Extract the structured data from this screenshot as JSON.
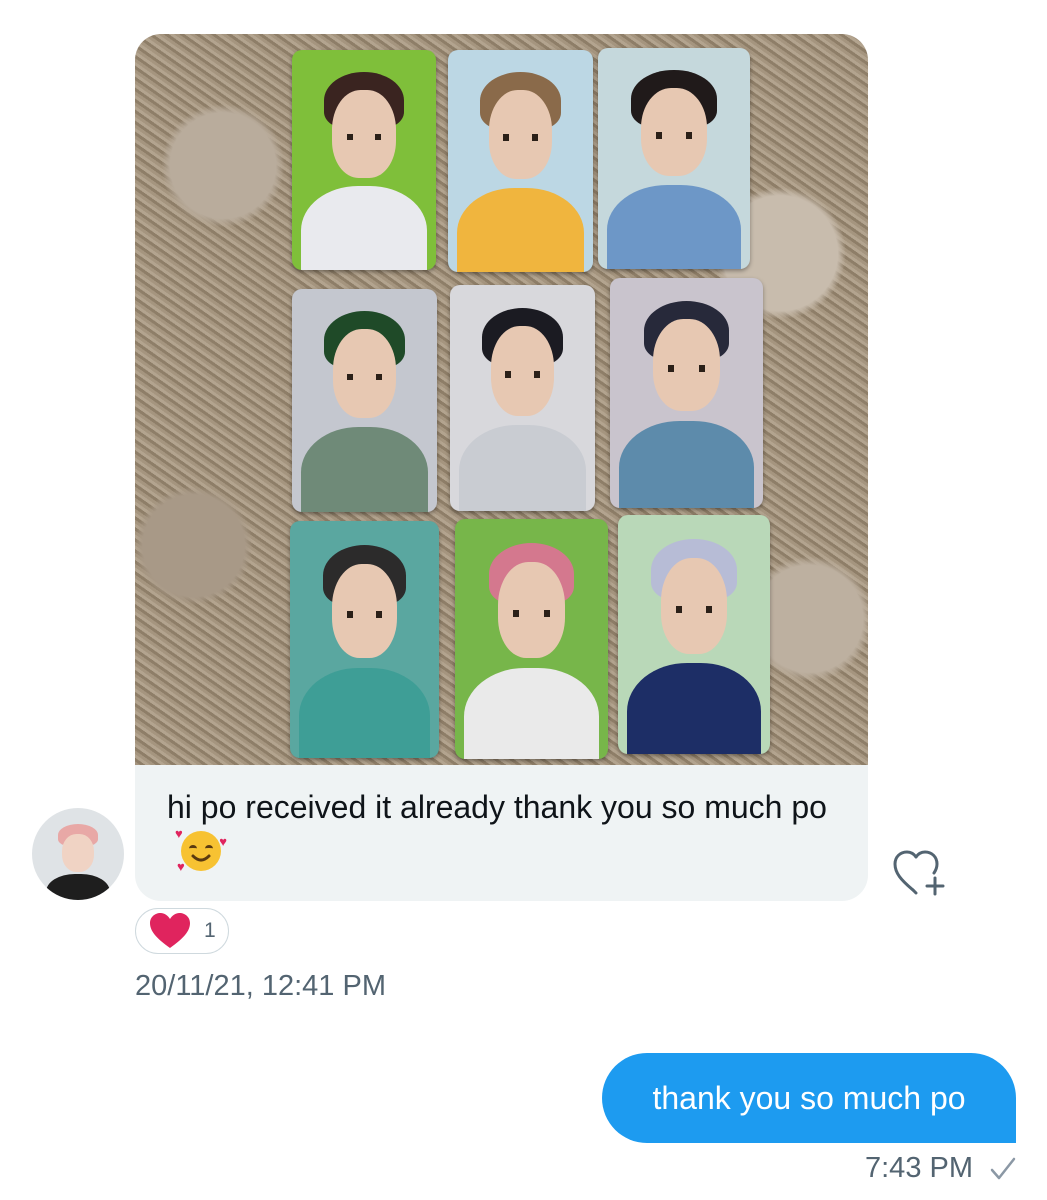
{
  "incoming_message": {
    "text": "hi po received it already thank you so much po",
    "emoji": "smiling-face-with-hearts",
    "timestamp": "20/11/21, 12:41 PM",
    "reaction": {
      "emoji": "heart",
      "count": "1"
    },
    "photo_cards": [
      {
        "bg": "#7fbf3a",
        "hair": "#3a2420",
        "shirt": "#e9eaee"
      },
      {
        "bg": "#bcd7e4",
        "hair": "#8a6a4a",
        "shirt": "#f0b53e"
      },
      {
        "bg": "#c5d8dc",
        "hair": "#201a1a",
        "shirt": "#6d97c7"
      },
      {
        "bg": "#c4c7cf",
        "hair": "#1f4a28",
        "shirt": "#6f8a78"
      },
      {
        "bg": "#d8d8dc",
        "hair": "#1b1b22",
        "shirt": "#c9ccd2"
      },
      {
        "bg": "#c9c4cd",
        "hair": "#27293a",
        "shirt": "#5d8bab"
      },
      {
        "bg": "#5aa7a0",
        "hair": "#2c2b2b",
        "shirt": "#3e9e96"
      },
      {
        "bg": "#77b64a",
        "hair": "#d4788e",
        "shirt": "#eaeaea"
      },
      {
        "bg": "#b9d8b8",
        "hair": "#b7bcd6",
        "shirt": "#1d2e66"
      }
    ]
  },
  "outgoing_message": {
    "text": "thank you so much po",
    "timestamp": "7:43 PM",
    "status_icon": "sent-check-icon"
  },
  "colors": {
    "accent": "#1d9bf0",
    "bubble_in": "#eff3f4",
    "heart": "#e0245e",
    "muted": "#536471"
  }
}
